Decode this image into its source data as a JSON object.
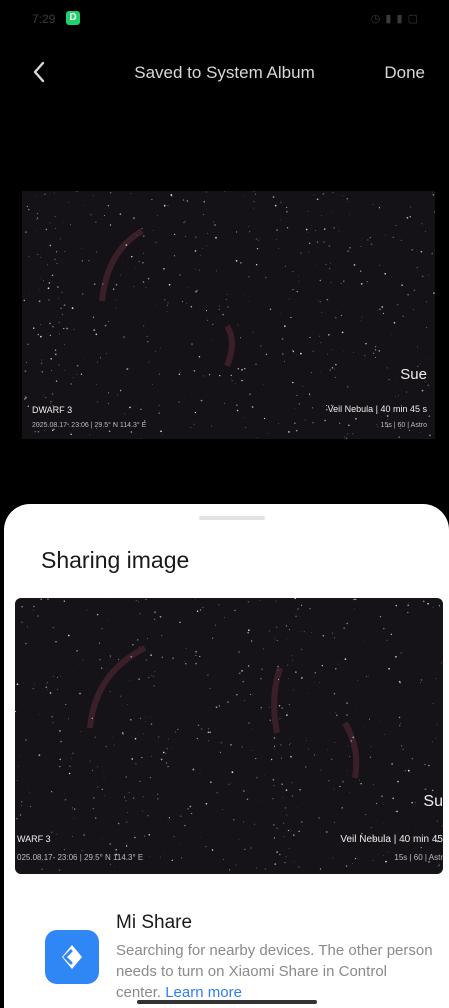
{
  "status_bar": {
    "time": "7:29",
    "app_badge": "D",
    "indicators": "◷ ▮ ▮ ▢"
  },
  "top_bar": {
    "title": "Saved to System Album",
    "done_label": "Done"
  },
  "photo": {
    "brand": "DWARF 3",
    "datetime": "2025.08.17- 23:06 | 29.5° N 114.3° E",
    "signature": "Sue",
    "target": "Veil Nebula | 40 min 45 s",
    "settings": "15s | 60 | Astro"
  },
  "sheet": {
    "title": "Sharing image",
    "preview": {
      "brand": "WARF 3",
      "datetime": "025.08.17- 23:06 | 29.5° N 114.3° E",
      "signature": "Su",
      "target": "Veil Nebula | 40 min 45",
      "settings": "15s | 60 | Astr"
    },
    "share_targets": [
      {
        "name": "Mi Share",
        "icon": "mi-share-icon",
        "description": "Searching for nearby devices. The other person needs to turn on Xiaomi Share in Control center.",
        "link": "Learn more"
      }
    ]
  },
  "colors": {
    "accent": "#2f86f5",
    "sheet_bg": "#ffffff",
    "page_bg": "#000000"
  }
}
